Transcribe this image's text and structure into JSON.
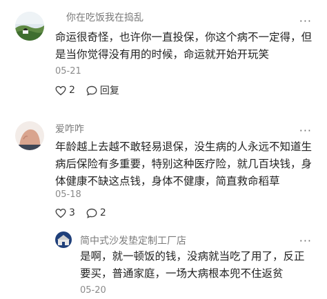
{
  "comments": [
    {
      "username": "你在吃饭我在捣乱",
      "lines": [
        "命运很奇怪，也许你一直投保，你这个病不一定得，但",
        "是当你觉得没有用的时候，命运就开始开玩笑"
      ],
      "date": "05-21",
      "likes": "2",
      "reply_label": "回复",
      "more": "···",
      "avatar_icon": "landscape-avatar"
    },
    {
      "username": "爱咋咋",
      "lines": [
        "年龄越上去越不敢轻易退保，没生病的人永远不知道生",
        "病后保险有多重要，特别这种医疗险，就几百块钱，身",
        "体健康不缺这点钱，身体不健康，简直救命稻草"
      ],
      "date": "05-18",
      "likes": "3",
      "replies": "2",
      "more": "···",
      "avatar_icon": "hand-avatar"
    },
    {
      "username": "简中式沙发垫定制工厂店",
      "lines": [
        "是啊，就一顿饭的钱，没病就当吃了用了，反正",
        "要买，普通家庭，一场大病根本兜不住返贫"
      ],
      "date": "05-20",
      "more": "···",
      "avatar_icon": "building-avatar"
    }
  ]
}
